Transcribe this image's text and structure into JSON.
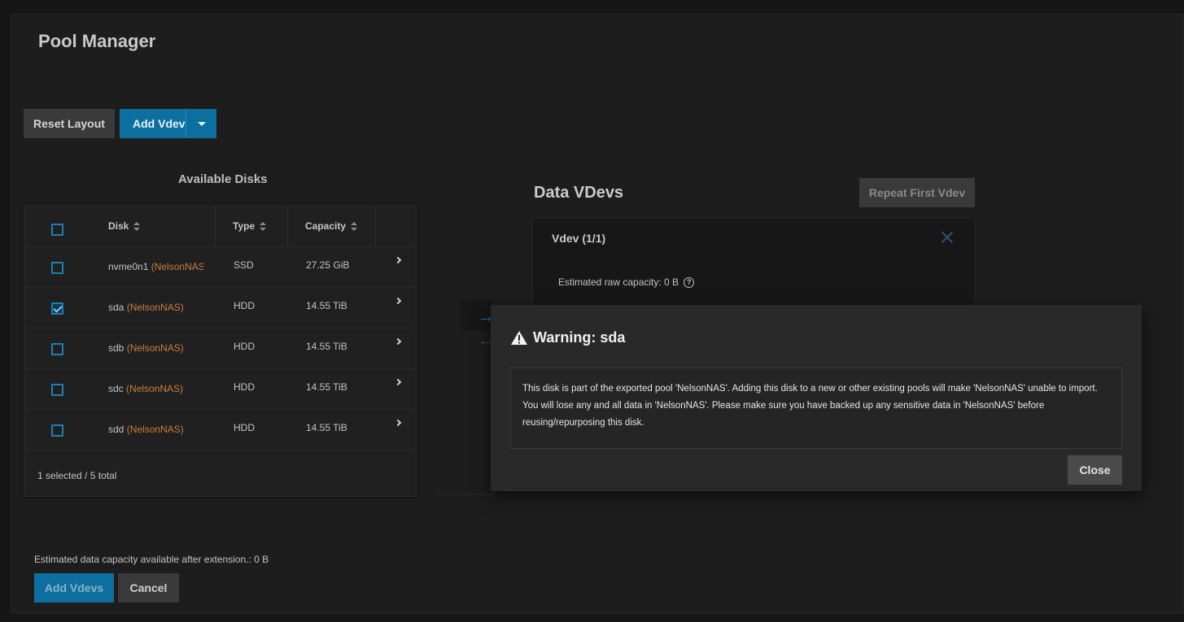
{
  "page": {
    "title": "Pool Manager"
  },
  "toolbar": {
    "reset_label": "Reset Layout",
    "add_vdev_label": "Add Vdev"
  },
  "available_disks": {
    "title": "Available Disks",
    "columns": {
      "disk": "Disk",
      "type": "Type",
      "capacity": "Capacity"
    },
    "rows": [
      {
        "name": "nvme0n1",
        "pool": "(NelsonNAS)",
        "type": "SSD",
        "capacity": "27.25 GiB",
        "checked": false
      },
      {
        "name": "sda",
        "pool": "(NelsonNAS)",
        "type": "HDD",
        "capacity": "14.55 TiB",
        "checked": true
      },
      {
        "name": "sdb",
        "pool": "(NelsonNAS)",
        "type": "HDD",
        "capacity": "14.55 TiB",
        "checked": false
      },
      {
        "name": "sdc",
        "pool": "(NelsonNAS)",
        "type": "HDD",
        "capacity": "14.55 TiB",
        "checked": false
      },
      {
        "name": "sdd",
        "pool": "(NelsonNAS)",
        "type": "HDD",
        "capacity": "14.55 TiB",
        "checked": false
      }
    ],
    "footer": "1 selected / 5 total"
  },
  "data_vdevs": {
    "title": "Data VDevs",
    "repeat_label": "Repeat First Vdev",
    "vdev_title": "Vdev (1/1)",
    "estimated_raw": "Estimated raw capacity: 0 B"
  },
  "bottom": {
    "estimated_text": "Estimated data capacity available after extension.: 0 B",
    "add_vdevs_label": "Add Vdevs",
    "cancel_label": "Cancel"
  },
  "dialog": {
    "title": "Warning: sda",
    "body": "This disk is part of the exported pool 'NelsonNAS'. Adding this disk to a new or other existing pools will make 'NelsonNAS' unable to import. You will lose any and all data in 'NelsonNAS'. Please make sure you have backed up any sensitive data in 'NelsonNAS' before reusing/repurposing this disk.",
    "close_label": "Close"
  },
  "colors": {
    "accent": "#0d6fa0",
    "pool_label": "#c87f3c",
    "background": "#1d1d1d"
  }
}
